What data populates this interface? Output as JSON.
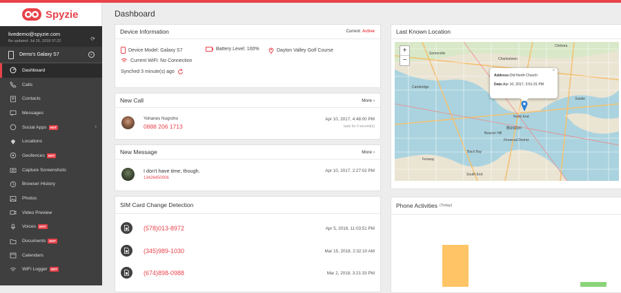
{
  "app": {
    "name": "Spyzie",
    "brand_color": "#e8424a"
  },
  "account": {
    "email": "livedemo@spyzie.com",
    "updated": "Be updated: Jul 26, 2018 07:22"
  },
  "device": {
    "name": "Demo's Galaxy S7"
  },
  "nav": [
    {
      "label": "Dashboard",
      "icon": "dashboard-icon",
      "active": true
    },
    {
      "label": "Calls",
      "icon": "phone-icon"
    },
    {
      "label": "Contacts",
      "icon": "contacts-icon"
    },
    {
      "label": "Messages",
      "icon": "message-icon"
    },
    {
      "label": "Social Apps",
      "icon": "chat-icon",
      "hot": "HOT"
    },
    {
      "label": "Locations",
      "icon": "location-pin-icon"
    },
    {
      "label": "Geofences",
      "icon": "geofence-icon",
      "hot": "HOT"
    },
    {
      "label": "Capture Screenshots",
      "icon": "camera-icon"
    },
    {
      "label": "Browser History",
      "icon": "history-icon"
    },
    {
      "label": "Photos",
      "icon": "photo-icon"
    },
    {
      "label": "Video Preview",
      "icon": "video-icon"
    },
    {
      "label": "Voices",
      "icon": "microphone-icon",
      "hot": "HOT"
    },
    {
      "label": "Documents",
      "icon": "folder-icon",
      "hot": "HOT"
    },
    {
      "label": "Calendars",
      "icon": "calendar-icon"
    },
    {
      "label": "WiFi Logger",
      "icon": "wifi-icon",
      "hot": "HOT"
    }
  ],
  "page": {
    "title": "Dashboard"
  },
  "device_info": {
    "title": "Device Information",
    "current_label": "Current:",
    "current_status": "Active",
    "model": "Device Model: Galaxy S7",
    "battery": "Battery Level: 100%",
    "location": "Dayton Valley Golf Course",
    "wifi": "Current WiFi: No Connection",
    "synced": "Synched 3 minute(s) ago"
  },
  "new_call": {
    "title": "New Call",
    "more": "More",
    "name": "Yohanes Nugroho",
    "number": "0888 206 1713",
    "date": "Apr 10, 2017, 4:48:00 PM",
    "duration": "lasts for 0 second(s)"
  },
  "new_message": {
    "title": "New Message",
    "more": "More",
    "text": "I don't have time, though.",
    "number": "13426450006",
    "date": "Apr 10, 2017, 2:27:02 PM"
  },
  "sim_change": {
    "title": "SIM Card Change Detection",
    "rows": [
      {
        "number": "(578)013-8972",
        "date": "Apr 5, 2018, 11:03:51 PM"
      },
      {
        "number": "(345)989-1030",
        "date": "Mar 15, 2018, 2:32:10 AM"
      },
      {
        "number": "(674)898-0988",
        "date": "Mar 2, 2018, 3:21:33 PM"
      }
    ]
  },
  "last_location": {
    "title": "Last Known Location",
    "zoom_in": "+",
    "zoom_out": "−",
    "popup_address_label": "Address:",
    "popup_address": "Old North Church",
    "popup_date_label": "Date:",
    "popup_date": "Apr 10, 2017, 3:51:31 PM",
    "close": "×",
    "map_labels": [
      "Somerville",
      "Cambridge",
      "Charlestown",
      "Chelsea",
      "North End",
      "Boston",
      "Financial District",
      "Back Bay",
      "South End",
      "Fenway",
      "Beacon Hill",
      "Eastie"
    ]
  },
  "phone_activities": {
    "title": "Phone Activities",
    "subtitle": "(Today)",
    "bars": [
      {
        "color": "#ffc466",
        "level": 0.45
      },
      {
        "color": "#8bd37a",
        "level": 0.05
      }
    ]
  }
}
